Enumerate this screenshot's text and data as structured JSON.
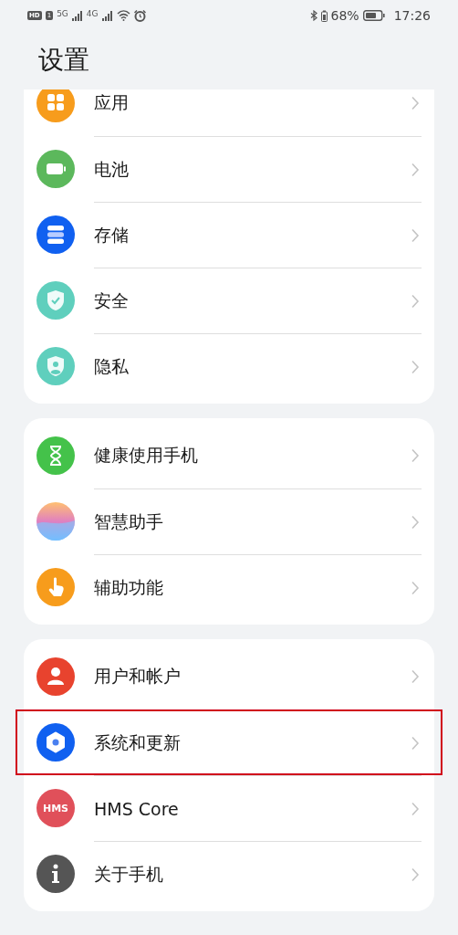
{
  "status_bar": {
    "hd": "HD",
    "sim": "1",
    "networks": [
      "5G",
      "4G"
    ],
    "battery_text": "68%",
    "time": "17:26"
  },
  "title": "设置",
  "groups": [
    {
      "items": [
        {
          "label": "应用",
          "kind": "apps",
          "color": "#f79c1c",
          "highlighted": false
        },
        {
          "label": "电池",
          "kind": "battery",
          "color": "#5cb85c",
          "highlighted": false
        },
        {
          "label": "存储",
          "kind": "storage",
          "color": "#1060f0",
          "highlighted": false
        },
        {
          "label": "安全",
          "kind": "shield",
          "color": "#5fcfbd",
          "highlighted": false
        },
        {
          "label": "隐私",
          "kind": "privacy",
          "color": "#5fcfbd",
          "highlighted": false
        }
      ]
    },
    {
      "items": [
        {
          "label": "健康使用手机",
          "kind": "hourglass",
          "color": "#44c24a",
          "highlighted": false
        },
        {
          "label": "智慧助手",
          "kind": "gradient",
          "highlighted": false
        },
        {
          "label": "辅助功能",
          "kind": "hand",
          "color": "#f79c1c",
          "highlighted": false
        }
      ]
    },
    {
      "items": [
        {
          "label": "用户和帐户",
          "kind": "user",
          "color": "#e8432e",
          "highlighted": false
        },
        {
          "label": "系统和更新",
          "kind": "gear",
          "color": "#1060f0",
          "highlighted": true
        },
        {
          "label": "HMS Core",
          "kind": "text",
          "icon_text": "HMS",
          "color": "#e0505a",
          "highlighted": false
        },
        {
          "label": "关于手机",
          "kind": "info",
          "color": "#555555",
          "highlighted": false
        }
      ]
    }
  ]
}
